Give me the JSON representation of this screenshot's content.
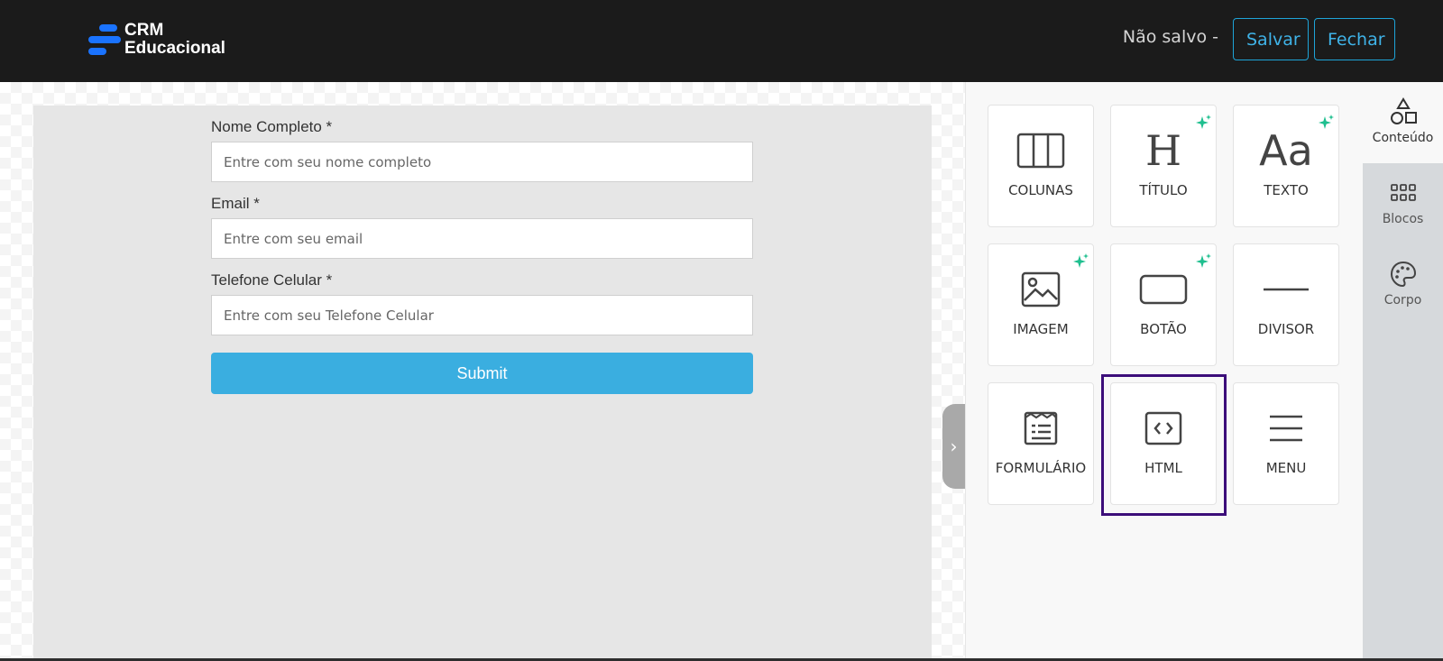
{
  "header": {
    "brand_line1": "CRM",
    "brand_line2": "Educacional",
    "status": "Não salvo -",
    "save_label": "Salvar",
    "close_label": "Fechar",
    "accent_color": "#1ea4d8",
    "logo_color": "#1a73ff"
  },
  "form": {
    "fields": [
      {
        "label": "Nome Completo *",
        "placeholder": "Entre com seu nome completo"
      },
      {
        "label": "Email *",
        "placeholder": "Entre com seu email"
      },
      {
        "label": "Telefone Celular *",
        "placeholder": "Entre com seu Telefone Celular"
      }
    ],
    "submit_label": "Submit",
    "submit_color": "#3aaee0"
  },
  "tiles": [
    {
      "label": "COLUNAS",
      "icon": "columns-icon",
      "ai": false
    },
    {
      "label": "TÍTULO",
      "icon": "heading-icon",
      "ai": true,
      "glyph": "H"
    },
    {
      "label": "TEXTO",
      "icon": "text-icon",
      "ai": true,
      "glyph": "Aa"
    },
    {
      "label": "IMAGEM",
      "icon": "image-icon",
      "ai": true
    },
    {
      "label": "BOTÃO",
      "icon": "button-icon",
      "ai": true
    },
    {
      "label": "DIVISOR",
      "icon": "divider-icon",
      "ai": false
    },
    {
      "label": "FORMULÁRIO",
      "icon": "form-icon",
      "ai": false
    },
    {
      "label": "HTML",
      "icon": "code-icon",
      "ai": false,
      "highlighted": true
    },
    {
      "label": "MENU",
      "icon": "menu-icon",
      "ai": false
    }
  ],
  "rail": {
    "tabs": [
      {
        "label": "Conteúdo",
        "icon": "shapes-icon",
        "active": true
      },
      {
        "label": "Blocos",
        "icon": "blocks-grid-icon",
        "active": false
      },
      {
        "label": "Corpo",
        "icon": "palette-icon",
        "active": false
      }
    ]
  },
  "colors": {
    "ai_spark": "#1fbf8f",
    "highlight": "#3c0e7a"
  }
}
